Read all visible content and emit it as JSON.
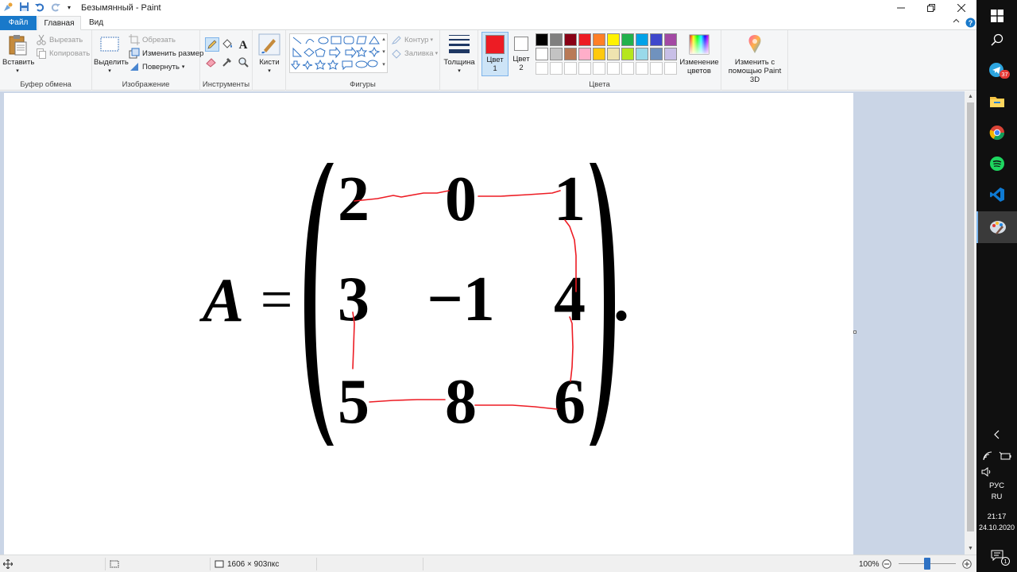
{
  "window": {
    "title": "Безымянный - Paint"
  },
  "tabs": {
    "file": "Файл",
    "home": "Главная",
    "view": "Вид"
  },
  "ribbon": {
    "clipboard": {
      "label": "Буфер обмена",
      "paste": "Вставить",
      "cut": "Вырезать",
      "copy": "Копировать"
    },
    "image": {
      "label": "Изображение",
      "select": "Выделить",
      "crop": "Обрезать",
      "resize": "Изменить размер",
      "rotate": "Повернуть"
    },
    "tools": {
      "label": "Инструменты"
    },
    "brushes": {
      "label": "Кисти"
    },
    "shapes": {
      "label": "Фигуры",
      "outline": "Контур",
      "fill": "Заливка"
    },
    "size": {
      "label": "Толщина"
    },
    "colors": {
      "label": "Цвета",
      "color1_line1": "Цвет",
      "color1_line2": "1",
      "color2_line1": "Цвет",
      "color2_line2": "2",
      "color1_value": "#ed1c24",
      "color2_value": "#ffffff",
      "edit_line1": "Изменение",
      "edit_line2": "цветов",
      "row1": [
        "#000000",
        "#7f7f7f",
        "#880015",
        "#ed1c24",
        "#ff7f27",
        "#fff200",
        "#22b14c",
        "#00a2e8",
        "#3f48cc",
        "#a349a4"
      ],
      "row2": [
        "#ffffff",
        "#c3c3c3",
        "#b97a57",
        "#ffaec9",
        "#ffc90e",
        "#efe4b0",
        "#b5e61d",
        "#99d9ea",
        "#7092be",
        "#c8bfe7"
      ]
    },
    "paint3d": {
      "line1": "Изменить с",
      "line2": "помощью Paint 3D"
    }
  },
  "canvas": {
    "matrix_name": "A",
    "equals": "=",
    "period": ".",
    "cells": [
      [
        "2",
        "0",
        "1"
      ],
      [
        "3",
        "−1",
        "4"
      ],
      [
        "5",
        "8",
        "6"
      ]
    ]
  },
  "statusbar": {
    "dimensions": "1606 × 903пкс",
    "zoom": "100%"
  },
  "taskbar": {
    "telegram_badge": "37",
    "lang_line1": "РУС",
    "lang_line2": "RU",
    "time": "21:17",
    "date": "24.10.2020",
    "notification_count": "1"
  }
}
